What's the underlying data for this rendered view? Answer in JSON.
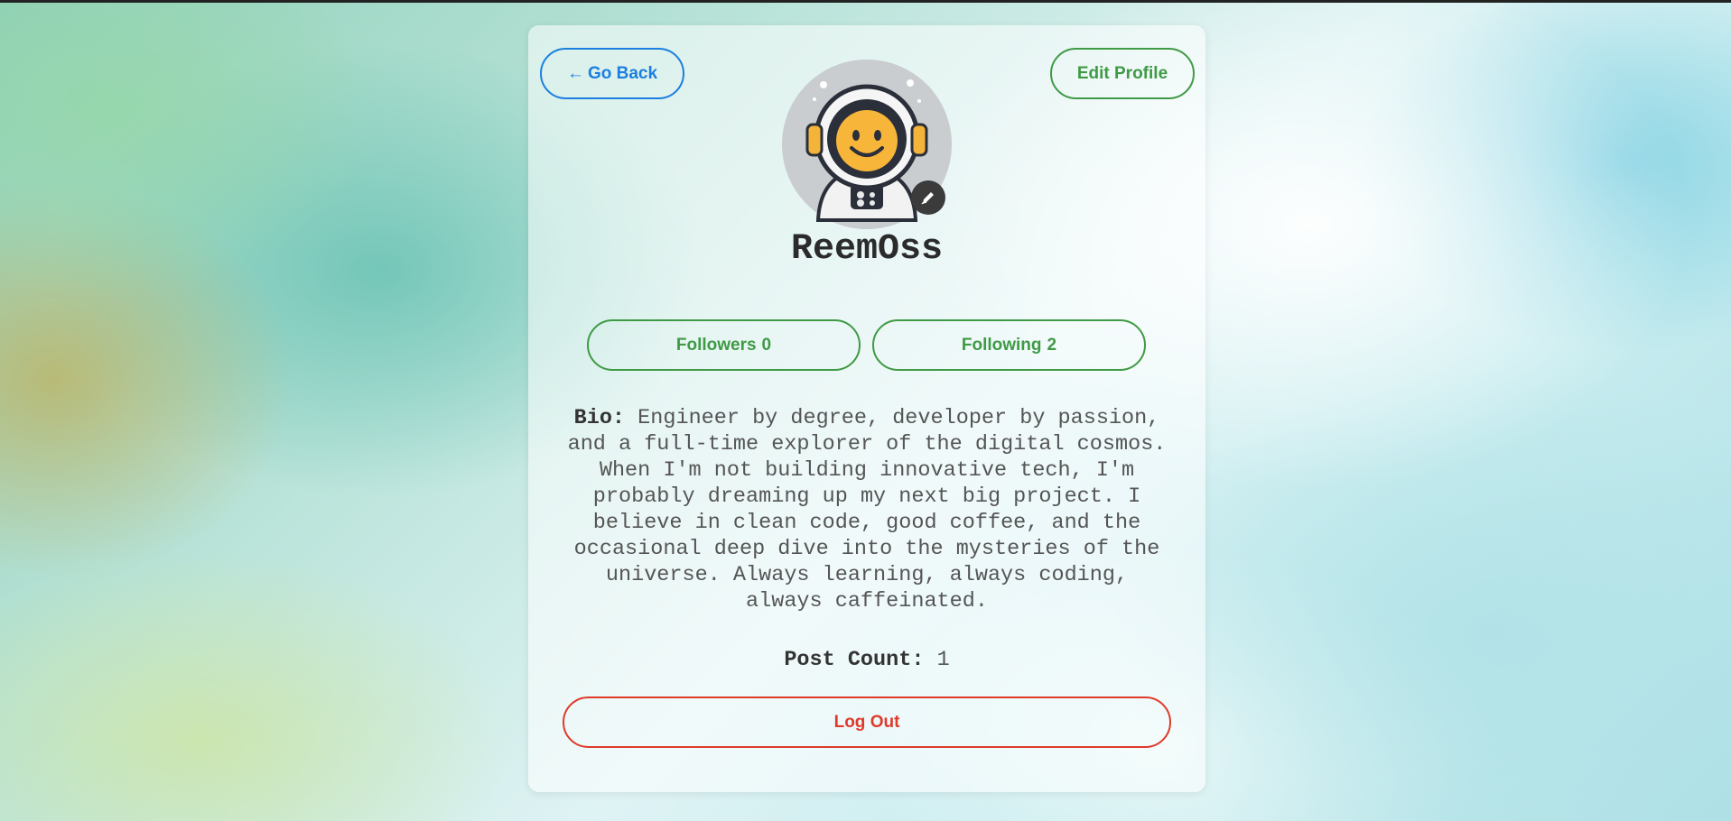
{
  "profile": {
    "back_label": "Go Back",
    "back_arrow": "←",
    "edit_label": "Edit Profile",
    "username": "ReemOss",
    "avatar_icon": "astronaut-avatar",
    "followers_label": "Followers",
    "followers_count": "0",
    "following_label": "Following",
    "following_count": "2",
    "bio_label": "Bio:",
    "bio_text": "Engineer by degree, developer by passion, and a full-time explorer of the digital cosmos. When I'm not building innovative tech, I'm probably dreaming up my next big project. I believe in clean code, good coffee, and the occasional deep dive into the mysteries of the universe. Always learning, always coding, always caffeinated.",
    "post_count_label": "Post Count:",
    "post_count": "1",
    "logout_label": "Log Out"
  },
  "colors": {
    "back": "#1a7fe0",
    "green": "#3f9a45",
    "logout": "#e03a2a"
  }
}
